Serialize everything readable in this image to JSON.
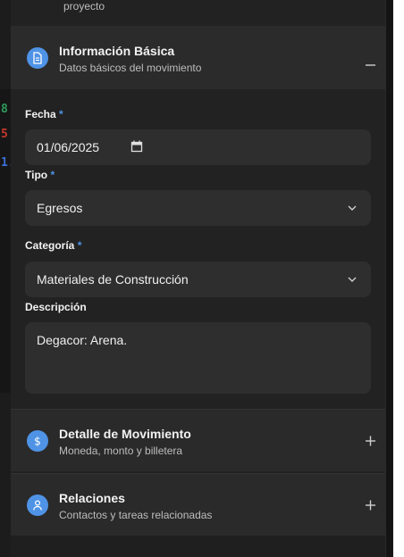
{
  "top_hint": "proyecto",
  "background": {
    "chars": [
      "8",
      "5",
      "1."
    ]
  },
  "section_basic": {
    "title": "Información Básica",
    "subtitle": "Datos básicos del movimiento",
    "icon": "document-icon",
    "state": "expanded"
  },
  "fields": {
    "fecha": {
      "label": "Fecha",
      "required": "*",
      "value": "01/06/2025"
    },
    "tipo": {
      "label": "Tipo",
      "required": "*",
      "value": "Egresos"
    },
    "categoria": {
      "label": "Categoría",
      "required": "*",
      "value": "Materiales de Construcción"
    },
    "descripcion": {
      "label": "Descripción",
      "value": "Degacor: Arena."
    }
  },
  "section_detail": {
    "title": "Detalle de Movimiento",
    "subtitle": "Moneda, monto y billetera",
    "icon": "dollar-icon",
    "state": "collapsed"
  },
  "section_relations": {
    "title": "Relaciones",
    "subtitle": "Contactos y tareas relacionadas",
    "icon": "user-icon",
    "state": "collapsed"
  },
  "colors": {
    "accent": "#4f93e6",
    "panel": "#222222",
    "field": "#2e2e2e"
  }
}
